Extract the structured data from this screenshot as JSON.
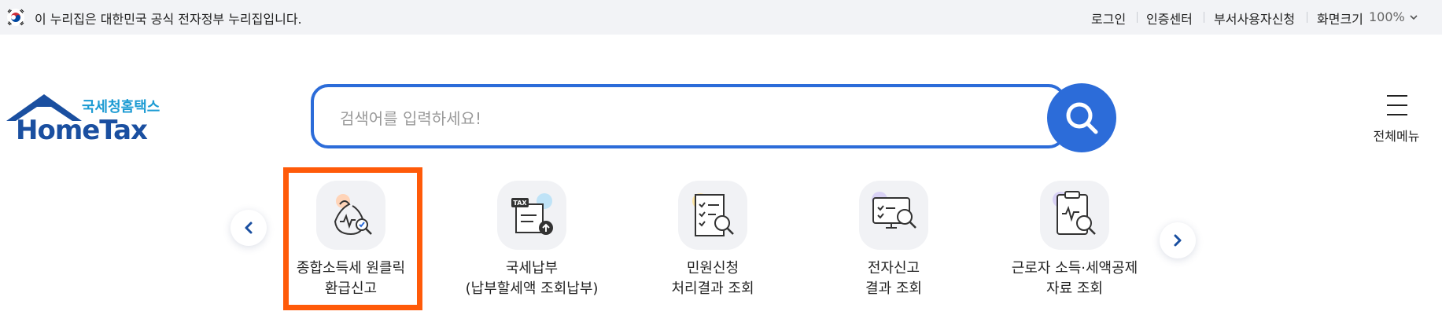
{
  "topbar": {
    "gov_notice": "이 누리집은 대한민국 공식 전자정부 누리집입니다.",
    "links": [
      "로그인",
      "인증센터",
      "부서사용자신청",
      "화면크기"
    ],
    "zoom": "100%"
  },
  "logo": {
    "ko": "국세청홈택스",
    "en": "HomeTax"
  },
  "search": {
    "placeholder": "검색어를 입력하세요!",
    "value": ""
  },
  "menu": {
    "label": "전체메뉴"
  },
  "services": [
    {
      "label": "종합소득세 원클릭\n환급신고",
      "icon": "money-bag-check-icon"
    },
    {
      "label": "국세납부\n(납부할세액 조회납부)",
      "icon": "tax-document-upload-icon"
    },
    {
      "label": "민원신청\n처리결과 조회",
      "icon": "checklist-search-icon"
    },
    {
      "label": "전자신고\n결과 조회",
      "icon": "monitor-search-icon"
    },
    {
      "label": "근로자 소득·세액공제\n자료 조회",
      "icon": "clipboard-search-icon"
    }
  ],
  "colors": {
    "accent": "#2c6cd9",
    "highlight": "#ff5a09",
    "logo_blue": "#1a4fa0",
    "logo_cyan": "#1c9bd3"
  }
}
